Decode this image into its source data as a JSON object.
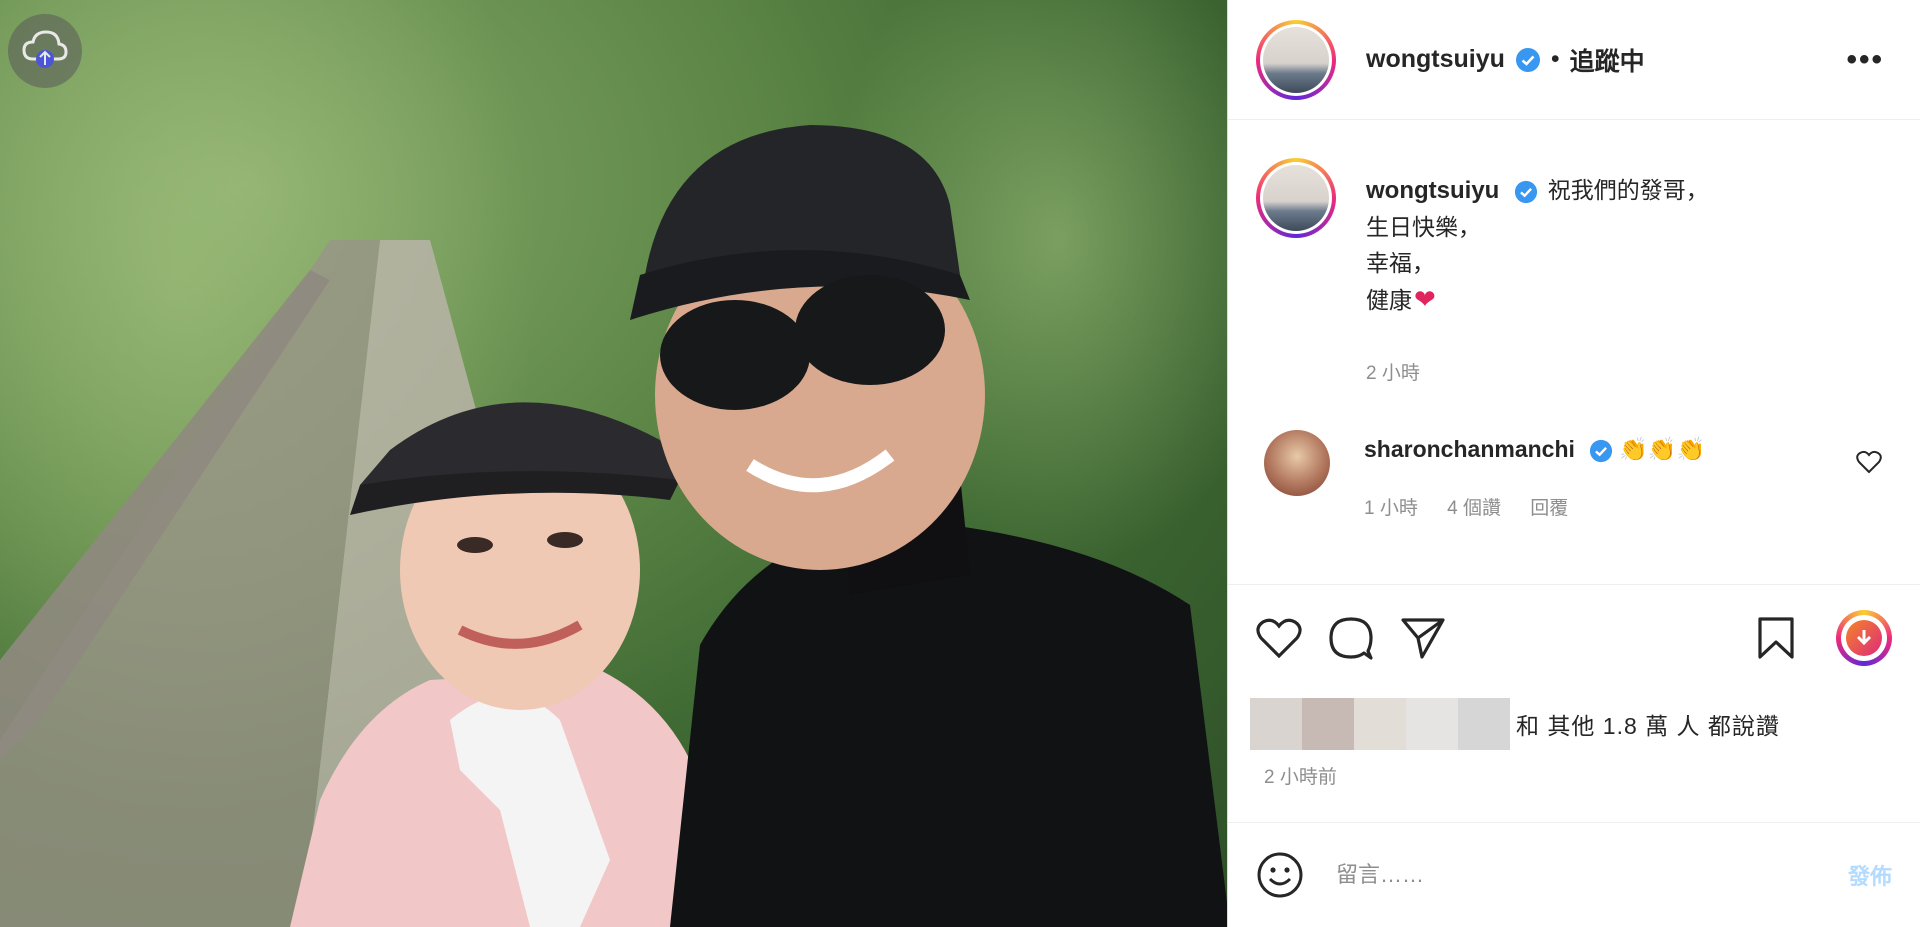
{
  "photo": {
    "alt": "",
    "upload_icon": "cloud-upload-icon"
  },
  "header": {
    "username": "wongtsuiyu",
    "separator": "•",
    "follow_status": "追蹤中",
    "more_label": "•••"
  },
  "caption": {
    "username": "wongtsuiyu",
    "lines": [
      "祝我們的發哥，",
      "生日快樂，",
      "幸福，",
      "健康"
    ],
    "heart_emoji": "❤",
    "time": "2 小時"
  },
  "comment": {
    "username": "sharonchanmanchi",
    "text": "👏👏👏",
    "time": "1 小時",
    "likes": "4 個讚",
    "reply": "回覆"
  },
  "likes": {
    "text": "和 其他 1.8 萬 人 都說讚",
    "blur_colors": [
      "#d9d4cf",
      "#c7b9b3",
      "#e3ddd8",
      "#e6e4e2",
      "#d6d6d6"
    ]
  },
  "post_time": "2 小時前",
  "comment_box": {
    "placeholder": "留言……",
    "post_label": "發佈"
  },
  "colors": {
    "verified": "#3897f0",
    "muted": "#8e8e8e",
    "post_disabled": "#b3dbff"
  }
}
